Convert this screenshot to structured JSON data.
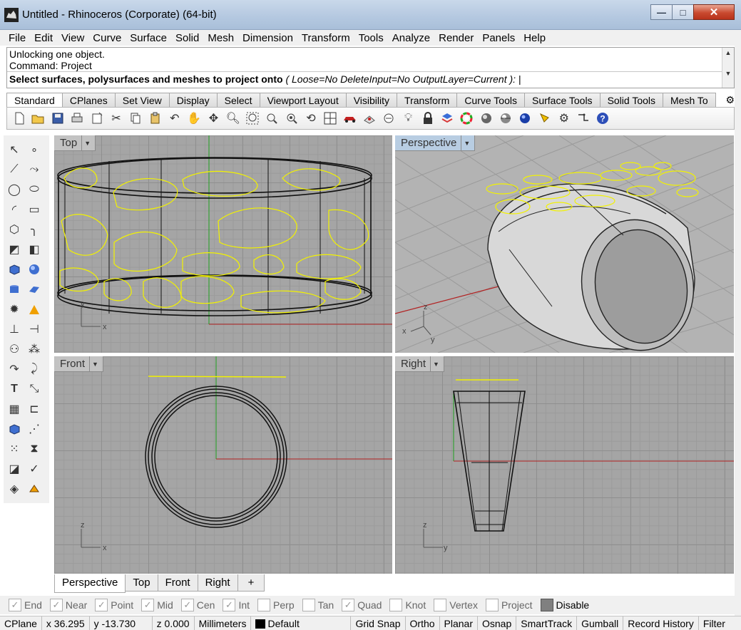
{
  "window": {
    "title": "Untitled - Rhinoceros (Corporate) (64-bit)",
    "minimize": "—",
    "maximize": "□",
    "close": "✕"
  },
  "menu": [
    "File",
    "Edit",
    "View",
    "Curve",
    "Surface",
    "Solid",
    "Mesh",
    "Dimension",
    "Transform",
    "Tools",
    "Analyze",
    "Render",
    "Panels",
    "Help"
  ],
  "command": {
    "history_1": "Unlocking one object.",
    "history_2": "Command: Project",
    "prompt": "Select surfaces, polysurfaces and meshes to project onto",
    "options": "( Loose=No  DeleteInput=No  OutputLayer=Current ):"
  },
  "toolbar_tabs": [
    "Standard",
    "CPlanes",
    "Set View",
    "Display",
    "Select",
    "Viewport Layout",
    "Visibility",
    "Transform",
    "Curve Tools",
    "Surface Tools",
    "Solid Tools",
    "Mesh To"
  ],
  "toolbar_icons": [
    "new-icon",
    "open-icon",
    "save-icon",
    "print-icon",
    "import-icon",
    "cut-icon",
    "copy-icon",
    "paste-icon",
    "undo-icon",
    "pan-icon",
    "rotate-view-icon",
    "zoom-icon",
    "zoom-window-icon",
    "zoom-extents-icon",
    "zoom-selected-icon",
    "rotate-camera-icon",
    "four-viewports-icon",
    "car-icon",
    "render-preview-icon",
    "hide-icon",
    "light-icon",
    "lock-icon",
    "layer-icon",
    "color-wheel-icon",
    "shaded-sphere-icon",
    "rendered-sphere-icon",
    "blue-sphere-icon",
    "spotlight-icon",
    "settings-icon",
    "grid-snap-icon",
    "help-icon"
  ],
  "viewports": {
    "top": "Top",
    "perspective": "Perspective",
    "front": "Front",
    "right": "Right"
  },
  "viewport_tabs": [
    "Perspective",
    "Top",
    "Front",
    "Right",
    "+"
  ],
  "osnaps": [
    {
      "label": "End",
      "checked": true,
      "enabled": false
    },
    {
      "label": "Near",
      "checked": true,
      "enabled": false
    },
    {
      "label": "Point",
      "checked": true,
      "enabled": false
    },
    {
      "label": "Mid",
      "checked": true,
      "enabled": false
    },
    {
      "label": "Cen",
      "checked": true,
      "enabled": false
    },
    {
      "label": "Int",
      "checked": true,
      "enabled": false
    },
    {
      "label": "Perp",
      "checked": false,
      "enabled": false
    },
    {
      "label": "Tan",
      "checked": false,
      "enabled": false
    },
    {
      "label": "Quad",
      "checked": true,
      "enabled": false
    },
    {
      "label": "Knot",
      "checked": false,
      "enabled": false
    },
    {
      "label": "Vertex",
      "checked": false,
      "enabled": false
    },
    {
      "label": "Project",
      "checked": false,
      "enabled": false
    },
    {
      "label": "Disable",
      "checked": false,
      "enabled": true
    }
  ],
  "status": {
    "cplane": "CPlane",
    "x": "x 36.295",
    "y": "y -13.730",
    "z": "z 0.000",
    "units": "Millimeters",
    "layer": "Default",
    "grid_snap": "Grid Snap",
    "ortho": "Ortho",
    "planar": "Planar",
    "osnap": "Osnap",
    "smarttrack": "SmartTrack",
    "gumball": "Gumball",
    "record_history": "Record History",
    "filter": "Filter"
  },
  "axis_labels": {
    "x": "x",
    "y": "y",
    "z": "z"
  },
  "colors": {
    "yellow_curve": "#f2f200",
    "x_axis": "#b22222",
    "y_axis": "#1fa01f",
    "viewport_bg": "#a5a5a5",
    "active_label": "#b8cde2"
  }
}
